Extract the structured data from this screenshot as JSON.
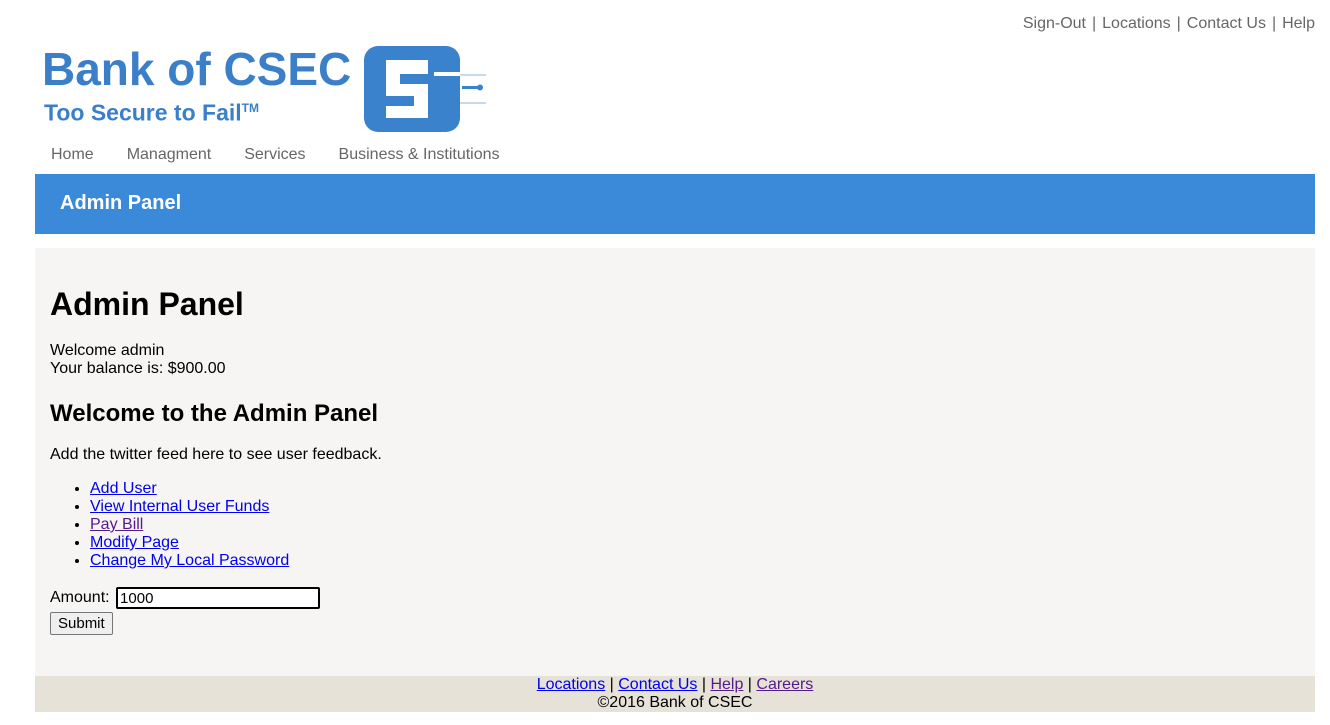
{
  "top_links": [
    "Sign-Out",
    "Locations",
    "Contact Us",
    "Help"
  ],
  "logo": {
    "name": "Bank of CSEC",
    "tagline": "Too Secure to Fail",
    "tm": "TM"
  },
  "nav": [
    "Home",
    "Managment",
    "Services",
    "Business & Institutions"
  ],
  "banner": {
    "title": "Admin Panel"
  },
  "content": {
    "heading": "Admin Panel",
    "welcome": "Welcome admin",
    "balance": "Your balance is: $900.00",
    "subheading": "Welcome to the Admin Panel",
    "feed_text": "Add the twitter feed here to see user feedback.",
    "links": [
      "Add User",
      "View Internal User Funds",
      "Pay Bill",
      "Modify Page",
      "Change My Local Password"
    ],
    "amount_label": "Amount:",
    "amount_value": "1000",
    "submit_label": "Submit"
  },
  "footer": {
    "links": [
      "Locations",
      "Contact Us",
      "Help",
      "Careers"
    ],
    "copyright": "©2016 Bank of CSEC"
  },
  "colors": {
    "brand_blue": "#3a8ad9",
    "logo_blue": "#3b7fc9",
    "content_bg": "#f6f5f3",
    "footer_bg": "#e6e2d8"
  }
}
